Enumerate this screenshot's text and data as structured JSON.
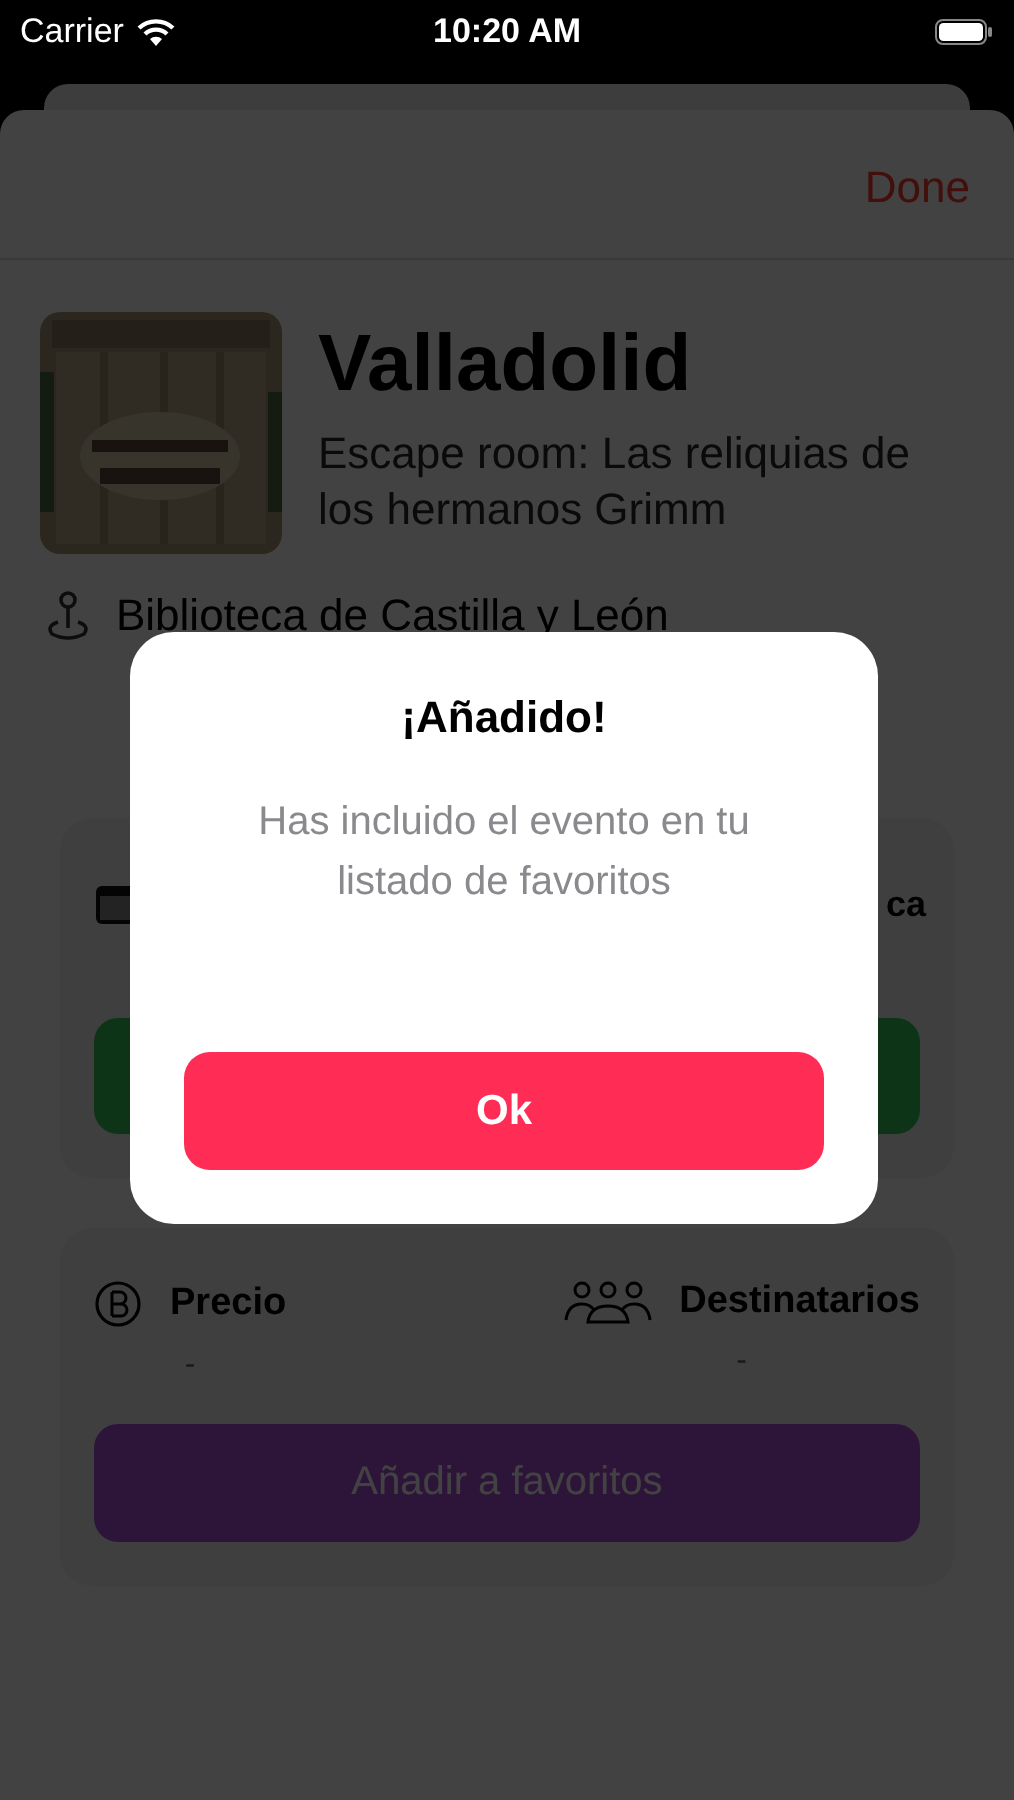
{
  "status_bar": {
    "carrier": "Carrier",
    "time": "10:20 AM"
  },
  "nav": {
    "done": "Done"
  },
  "event": {
    "city": "Valladolid",
    "title": "Escape room: Las reliquias de los hermanos Grimm",
    "location": "Biblioteca de Castilla y León"
  },
  "date_card": {
    "label": "ca"
  },
  "info_card": {
    "items": [
      {
        "kind": "price",
        "label": "Precio",
        "value": "-"
      },
      {
        "kind": "audience",
        "label": "Destinatarios",
        "value": "-"
      }
    ],
    "button": "Añadir a favoritos"
  },
  "alert": {
    "title": "¡Añadido!",
    "message": "Has incluido el evento en tu listado de favoritos",
    "button": "Ok"
  }
}
